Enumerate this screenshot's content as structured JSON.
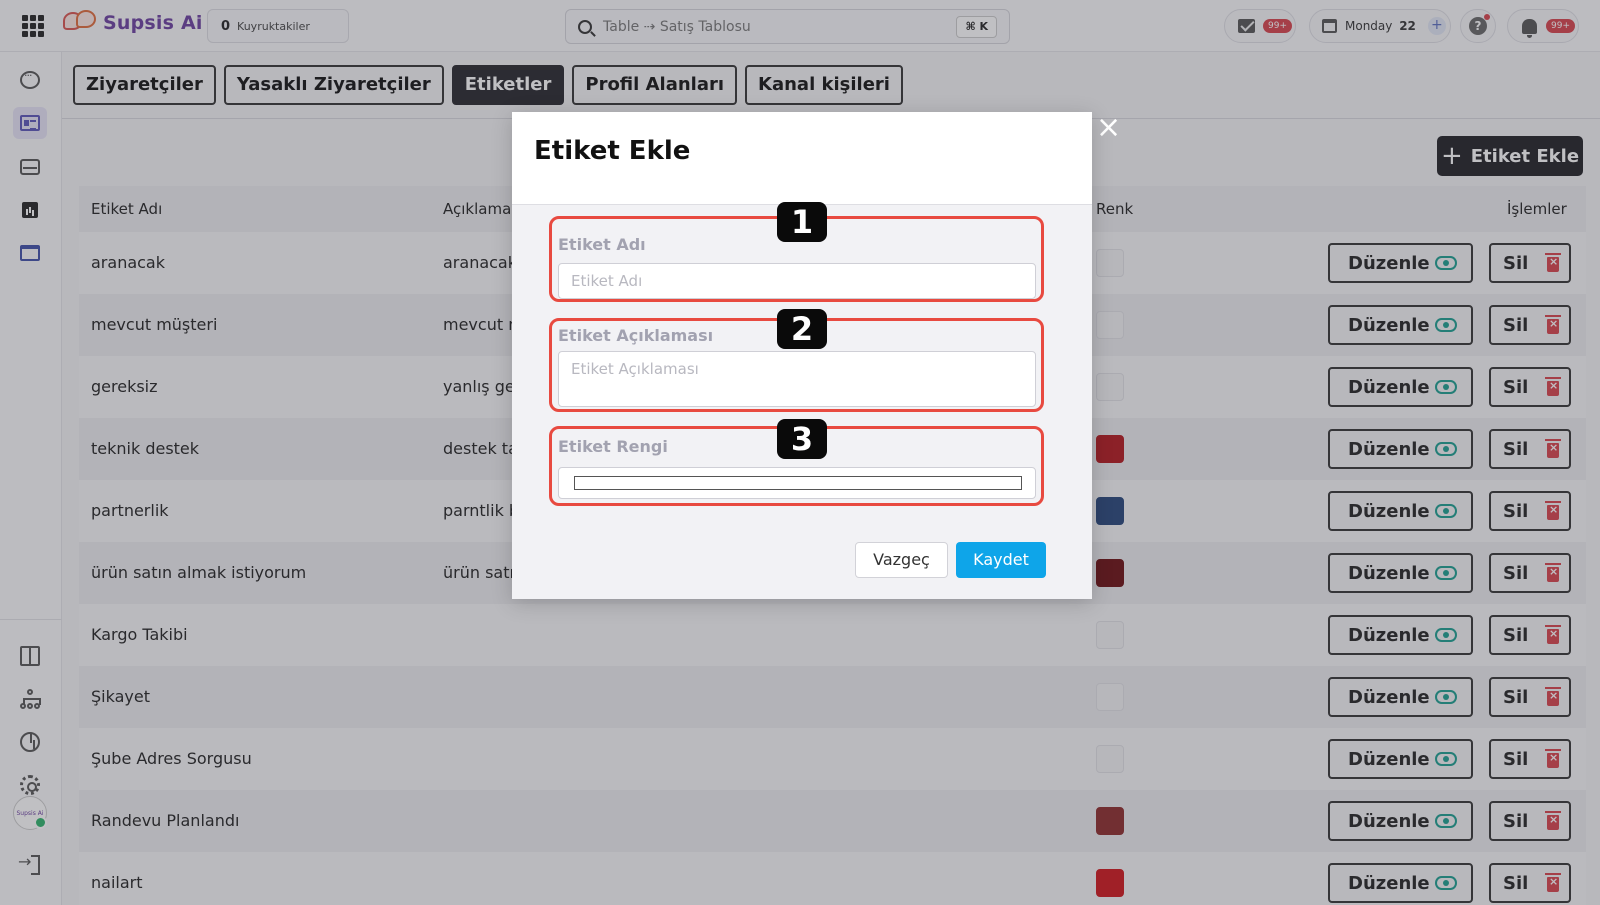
{
  "topbar": {
    "logo_text": "Supsis Ai",
    "queue_count": "0",
    "queue_label": "Kuyruktakiler",
    "search_placeholder": "Table ⇢ Satış Tablosu",
    "search_shortcut": "⌘ K",
    "mail_badge": "99+",
    "day_name": "Monday",
    "day_number": "22",
    "notification_badge": "99+"
  },
  "sidebar": {
    "avatar_text": "Supsis Ai"
  },
  "tabs": [
    {
      "label": "Ziyaretçiler"
    },
    {
      "label": "Yasaklı Ziyaretçiler"
    },
    {
      "label": "Etiketler"
    },
    {
      "label": "Profil Alanları"
    },
    {
      "label": "Kanal kişileri"
    }
  ],
  "add_button_label": "Etiket Ekle",
  "table": {
    "headers": {
      "name": "Etiket Adı",
      "desc": "Açıklama",
      "color": "Renk",
      "actions": "İşlemler"
    },
    "edit_label": "Düzenle",
    "delete_label": "Sil",
    "rows": [
      {
        "name": "aranacak",
        "desc": "aranacak",
        "color": "#f2f2f4"
      },
      {
        "name": "mevcut müşteri",
        "desc": "mevcut m",
        "color": "#f2f2f4"
      },
      {
        "name": "gereksiz",
        "desc": "yanlış ge",
        "color": "#f2f2f4"
      },
      {
        "name": "teknik destek",
        "desc": "destek ta",
        "color": "#b3161b"
      },
      {
        "name": "partnerlik",
        "desc": "parntlik b",
        "color": "#25457a"
      },
      {
        "name": "ürün satın almak istiyorum",
        "desc": "ürün satı",
        "color": "#6b0d0f"
      },
      {
        "name": "Kargo Takibi",
        "desc": "",
        "color": "#f2f2f4"
      },
      {
        "name": "Şikayet",
        "desc": "",
        "color": "#f2f2f4"
      },
      {
        "name": "Şube Adres Sorgusu",
        "desc": "",
        "color": "#f2f2f4"
      },
      {
        "name": "Randevu Planlandı",
        "desc": "",
        "color": "#8c2a2a"
      },
      {
        "name": "nailart",
        "desc": "",
        "color": "#d0141a"
      }
    ]
  },
  "modal": {
    "title": "Etiket Ekle",
    "close": "×",
    "fields": {
      "name_label": "Etiket Adı",
      "name_placeholder": "Etiket Adı",
      "desc_label": "Etiket Açıklaması",
      "desc_placeholder": "Etiket Açıklaması",
      "color_label": "Etiket Rengi"
    },
    "markers": [
      "1",
      "2",
      "3"
    ],
    "cancel_label": "Vazgeç",
    "save_label": "Kaydet"
  },
  "colors": {
    "accent": "#0ea5e9",
    "highlight": "#e84a40",
    "delete": "#d8414a",
    "view": "#1a9e8f"
  }
}
